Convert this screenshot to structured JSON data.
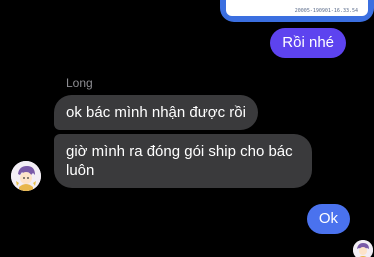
{
  "attachment": {
    "caption": "20005-190901-16.33.54"
  },
  "messages": {
    "outgoing_1": "Rồi nhé",
    "sender_name": "Long",
    "incoming_1": "ok bác mình nhận được rồi",
    "incoming_2": "giờ mình ra đóng gói ship cho bác luôn",
    "outgoing_2": "Ok"
  },
  "icons": {
    "contact_avatar": "avatar-icon",
    "read_receipt_avatar": "avatar-icon"
  },
  "colors": {
    "background": "#000000",
    "outgoing_bubble_top": "#5d43ef",
    "outgoing_bubble_bottom": "#4a72ee",
    "incoming_bubble": "#3a3a3c",
    "sender_name": "#8e8e93"
  }
}
